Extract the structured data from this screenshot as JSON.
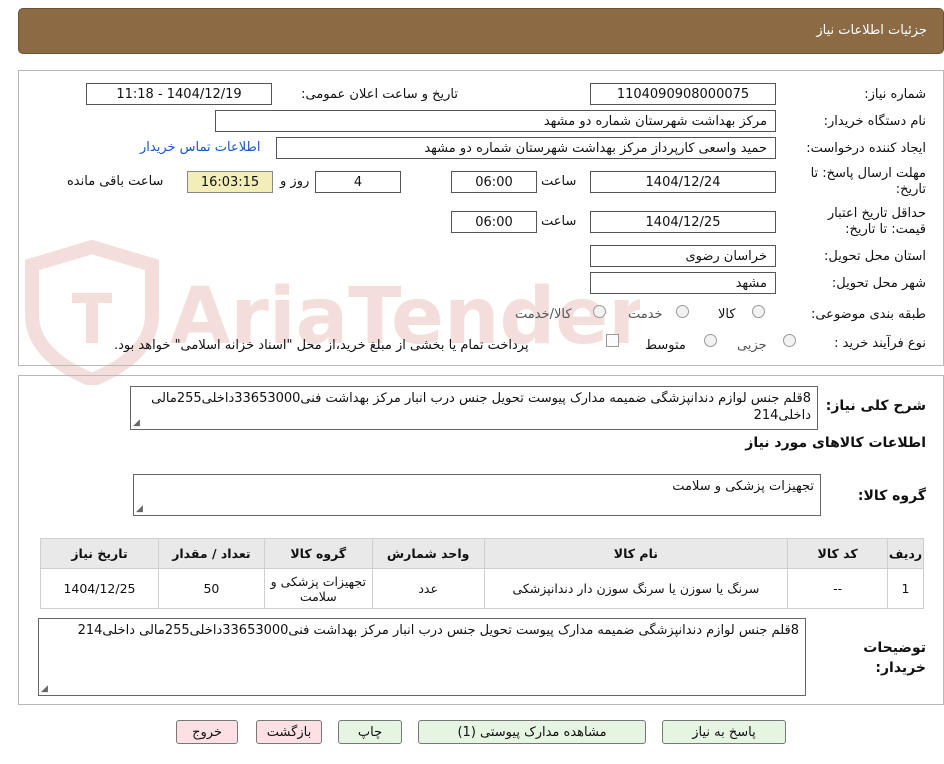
{
  "header": {
    "title": "جزئیات اطلاعات نیاز"
  },
  "labels": {
    "need_number": "شماره نیاز:",
    "announce": "تاریخ و ساعت اعلان عمومی:",
    "buyer_org": "نام دستگاه خریدار:",
    "requester": "ایجاد کننده درخواست:",
    "deadline": "مهلت ارسال پاسخ: تا تاریخ:",
    "time": "ساعت",
    "days_and": "روز و",
    "remaining": "ساعت باقی مانده",
    "min_valid": "حداقل تاریخ اعتبار قیمت: تا تاریخ:",
    "province": "استان محل تحویل:",
    "city": "شهر محل تحویل:",
    "category": "طبقه بندی موضوعی:",
    "process": "نوع فرآیند خرید :",
    "general_desc": "شرح کلی نیاز:",
    "goods_info": "اطلاعات کالاهای مورد نیاز",
    "goods_group": "گروه کالا:",
    "buyer_notes": "توضیحات خریدار:"
  },
  "values": {
    "need_number": "1104090908000075",
    "announce": "1404/12/19 - 11:18",
    "buyer_org": "مرکز بهداشت شهرستان شماره دو مشهد",
    "requester": "حمید واسعی کارپرداز مرکز بهداشت شهرستان شماره دو مشهد",
    "contact_link": "اطلاعات تماس خریدار",
    "deadline_date": "1404/12/24",
    "deadline_time": "06:00",
    "days": "4",
    "remaining_time": "16:03:15",
    "valid_date": "1404/12/25",
    "valid_time": "06:00",
    "province": "خراسان رضوی",
    "city": "مشهد",
    "general_desc": "8قلم جنس لوازم دندانپزشگی ضمیمه مدارک پیوست تحویل جنس درب انبار مرکز بهداشت فنی33653000داخلی255مالی داخلی214",
    "goods_group": "تجهیزات پزشکی و سلامت",
    "buyer_notes": "8قلم جنس لوازم دندانپزشگی ضمیمه مدارک پیوست تحویل جنس درب انبار مرکز بهداشت فنی33653000داخلی255مالی داخلی214"
  },
  "category_options": [
    "کالا",
    "خدمت",
    "کالا/خدمت"
  ],
  "category_selected": "کالا",
  "process_options": [
    "جزیی",
    "متوسط"
  ],
  "process_selected": "جزیی",
  "payment_note": "پرداخت تمام یا بخشی از مبلغ خرید،از محل \"اسناد خزانه اسلامی\" خواهد بود.",
  "table": {
    "headers": [
      "ردیف",
      "کد کالا",
      "نام کالا",
      "واحد شمارش",
      "گروه کالا",
      "تعداد / مقدار",
      "تاریخ نیاز"
    ],
    "rows": [
      [
        "1",
        "--",
        "سرنگ یا سوزن یا سرنگ سوزن دار دندانپزشکی",
        "عدد",
        "تجهیزات پزشکی و سلامت",
        "50",
        "1404/12/25"
      ]
    ]
  },
  "buttons": {
    "reply": "پاسخ به نیاز",
    "attachments": "مشاهده مدارک پیوستی (1)",
    "print": "چاپ",
    "back": "بازگشت",
    "exit": "خروج"
  },
  "watermark": {
    "text": "AriaTender.neT",
    "color": "#c0392b"
  }
}
